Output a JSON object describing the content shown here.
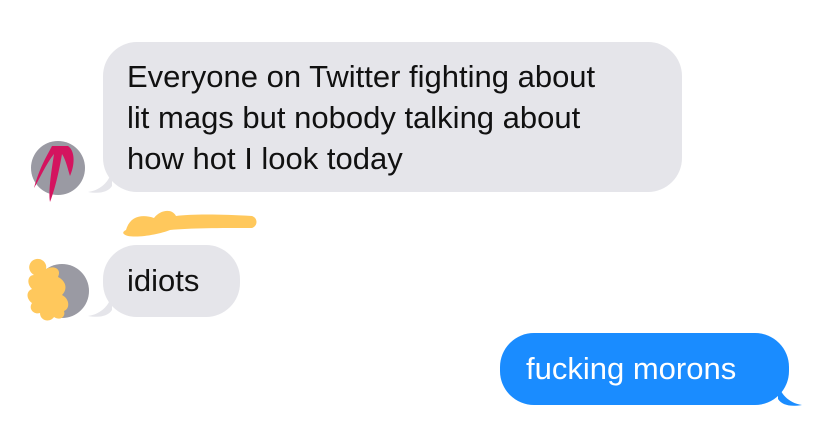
{
  "conversation": {
    "messages": [
      {
        "direction": "incoming",
        "text": "Everyone on Twitter fighting about\nlit mags but nobody talking about\nhow hot I look today"
      },
      {
        "direction": "incoming",
        "text": "idiots"
      },
      {
        "direction": "outgoing",
        "text": "fucking morons"
      }
    ]
  },
  "colors": {
    "incoming_bubble": "#e5e5ea",
    "outgoing_bubble": "#1a8cff",
    "avatar_gray": "#9a9aa3",
    "redaction_pink": "#d4145f",
    "redaction_yellow": "#ffc85c"
  },
  "icons": {
    "avatar_1": "avatar-redacted-pink",
    "avatar_2": "avatar-redacted-yellow",
    "name_redaction": "redaction-scribble"
  }
}
